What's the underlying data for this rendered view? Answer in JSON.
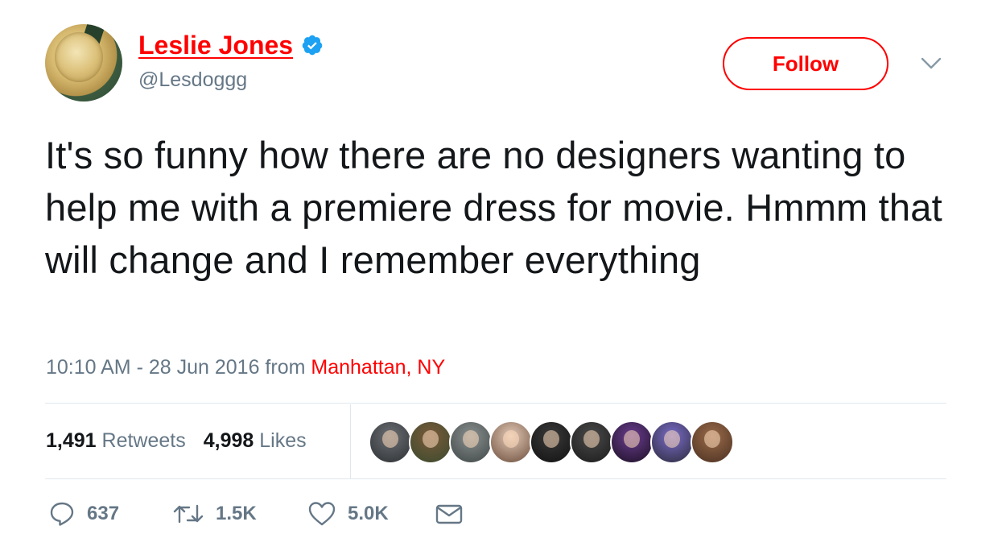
{
  "user": {
    "display_name": "Leslie Jones",
    "handle": "@Lesdoggg",
    "verified": true,
    "avatar_icon": "avatar-medal"
  },
  "follow_button": {
    "label": "Follow"
  },
  "tweet": {
    "text": "It's so funny how there are no designers wanting to help me with a premiere dress for movie. Hmmm that will change and I remember everything",
    "time": "10:10 AM - 28 Jun 2016",
    "from_label": "from",
    "location": "Manhattan, NY"
  },
  "stats": {
    "retweets_count": "1,491",
    "retweets_label": "Retweets",
    "likes_count": "4,998",
    "likes_label": "Likes"
  },
  "liker_avatars": [
    {
      "colors": [
        "#6b6f73",
        "#2d3033"
      ]
    },
    {
      "colors": [
        "#7a5b3a",
        "#3a4a2e"
      ]
    },
    {
      "colors": [
        "#8a9090",
        "#3f4646"
      ]
    },
    {
      "colors": [
        "#e3c9b6",
        "#6b4c3b"
      ]
    },
    {
      "colors": [
        "#3a3a3a",
        "#111111"
      ]
    },
    {
      "colors": [
        "#4a4a4a",
        "#1b1b1b"
      ]
    },
    {
      "colors": [
        "#6a3d8f",
        "#1c1024"
      ]
    },
    {
      "colors": [
        "#7a6cc9",
        "#2b2b3a"
      ]
    },
    {
      "colors": [
        "#9a6b4a",
        "#4a3021"
      ]
    }
  ],
  "actions": {
    "reply_count": "637",
    "retweet_count": "1.5K",
    "like_count": "5.0K"
  },
  "colors": {
    "accent": "#ff0000",
    "verified_badge": "#1da1f2",
    "secondary_text": "#657786",
    "primary_text": "#14171a",
    "divider": "#e1e8ed"
  }
}
